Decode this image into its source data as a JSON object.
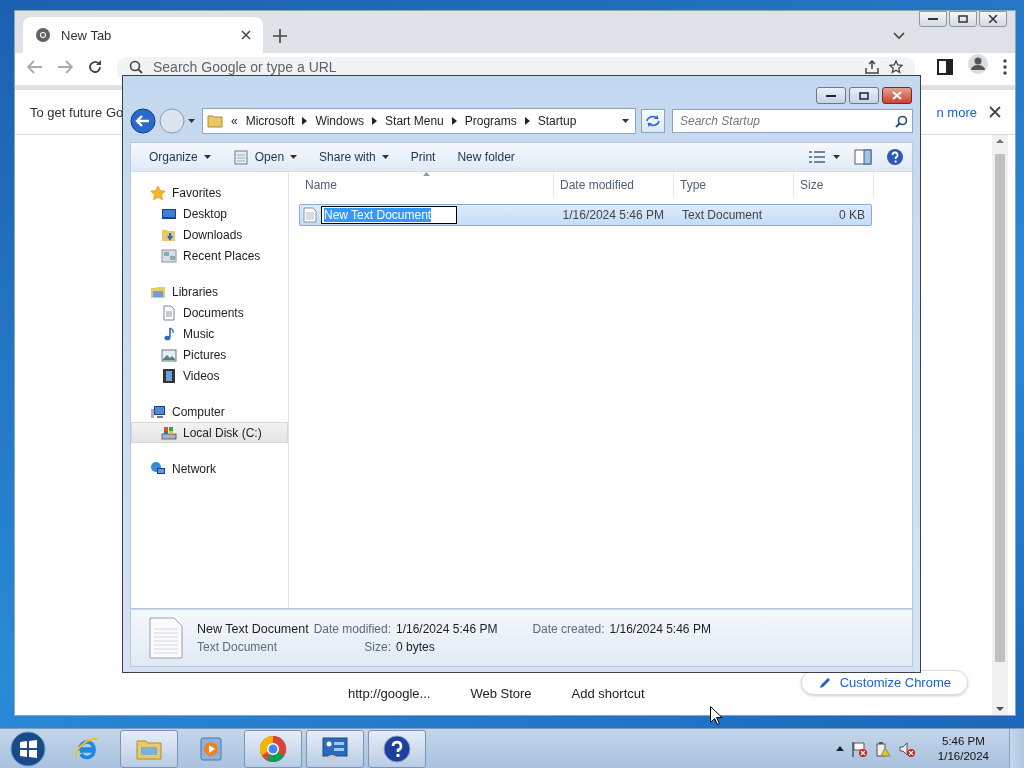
{
  "chrome": {
    "tab": {
      "title": "New Tab"
    },
    "address_bar": {
      "placeholder": "Search Google or type a URL"
    },
    "infobar": {
      "text": "To get future Go",
      "link": "n more"
    },
    "shortcuts": [
      "http://google...",
      "Web Store",
      "Add shortcut"
    ],
    "customize_button": "Customize Chrome"
  },
  "explorer": {
    "breadcrumb": {
      "overflow_mark": "«",
      "parts": [
        "Microsoft",
        "Windows",
        "Start Menu",
        "Programs",
        "Startup"
      ]
    },
    "search": {
      "placeholder": "Search Startup"
    },
    "commands": [
      {
        "label": "Organize",
        "kind": "menu"
      },
      {
        "label": "Open",
        "kind": "app-menu"
      },
      {
        "label": "Share with",
        "kind": "menu"
      },
      {
        "label": "Print",
        "kind": "plain"
      },
      {
        "label": "New folder",
        "kind": "plain"
      }
    ],
    "navigation": [
      {
        "label": "Favorites",
        "selected": false,
        "children": [
          {
            "label": "Desktop",
            "selected": false
          },
          {
            "label": "Downloads",
            "selected": false
          },
          {
            "label": "Recent Places",
            "selected": false
          }
        ]
      },
      {
        "label": "Libraries",
        "selected": false,
        "children": [
          {
            "label": "Documents",
            "selected": false
          },
          {
            "label": "Music",
            "selected": false
          },
          {
            "label": "Pictures",
            "selected": false
          },
          {
            "label": "Videos",
            "selected": false
          }
        ]
      },
      {
        "label": "Computer",
        "selected": false,
        "children": [
          {
            "label": "Local Disk (C:)",
            "selected": true
          }
        ]
      },
      {
        "label": "Network",
        "selected": false
      }
    ],
    "columns": [
      {
        "label": "Name",
        "sorted": true
      },
      {
        "label": "Date modified",
        "sorted": false
      },
      {
        "label": "Type",
        "sorted": false
      },
      {
        "label": "Size",
        "sorted": false
      }
    ],
    "files": [
      {
        "name": "New Text Document",
        "date_modified": "1/16/2024 5:46 PM",
        "type": "Text Document",
        "size": "0 KB",
        "selected": true,
        "renaming": true
      }
    ],
    "details": {
      "name": "New Text Document",
      "type": "Text Document",
      "fields": [
        {
          "label": "Date modified:",
          "value": "1/16/2024 5:46 PM"
        },
        {
          "label": "Date created:",
          "value": "1/16/2024 5:46 PM"
        },
        {
          "label": "Size:",
          "value": "0 bytes"
        }
      ]
    }
  },
  "taskbar": {
    "apps": [
      {
        "running": false
      },
      {
        "running": true
      },
      {
        "running": false
      },
      {
        "running": true
      },
      {
        "running": true
      },
      {
        "running": true
      }
    ],
    "clock": {
      "time": "5:46 PM",
      "date": "1/16/2024"
    }
  }
}
